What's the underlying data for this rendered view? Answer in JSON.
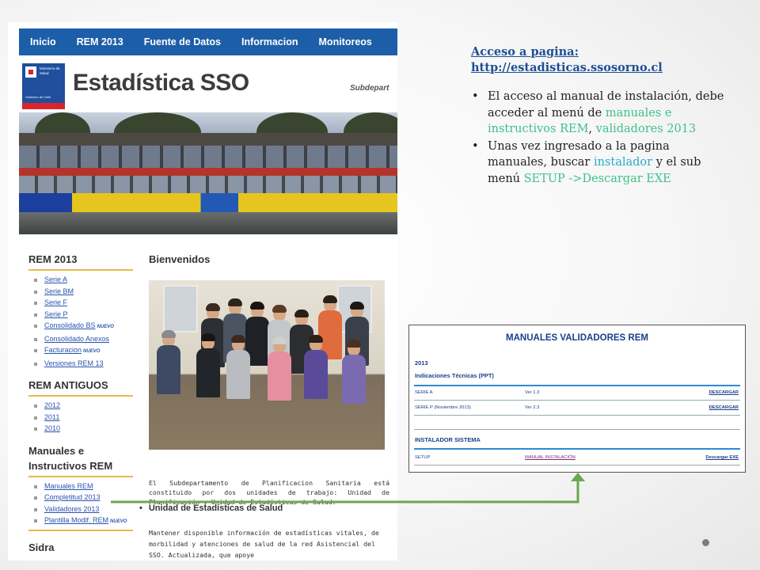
{
  "site": {
    "nav": [
      "Inicio",
      "REM 2013",
      "Fuente de Datos",
      "Informacion",
      "Monitoreos"
    ],
    "logo": {
      "line1": "Ministerio de",
      "line2": "Salud",
      "line3": "Gobierno de Chile"
    },
    "title": "Estadística SSO",
    "subtitle": "Subdepart",
    "sidebar": {
      "rem2013_heading": "REM 2013",
      "rem2013_items": [
        {
          "label": "Serie A",
          "badge": ""
        },
        {
          "label": "Serie BM",
          "badge": ""
        },
        {
          "label": "Serie F",
          "badge": ""
        },
        {
          "label": "Serie P",
          "badge": ""
        },
        {
          "label": "Consolidado BS",
          "badge": "NUEVO"
        },
        {
          "label": "Consolidado Anexos",
          "badge": ""
        },
        {
          "label": "Facturacion",
          "badge": "NUEVO"
        },
        {
          "label": "Versiones REM 13",
          "badge": ""
        }
      ],
      "antiguos_heading": "REM ANTIGUOS",
      "antiguos_items": [
        "2012",
        "2011",
        "2010"
      ],
      "manuales_heading_1": "Manuales e",
      "manuales_heading_2": "Instructivos REM",
      "manuales_items": [
        {
          "label": "Manuales REM",
          "badge": ""
        },
        {
          "label": "Completitud 2013",
          "badge": ""
        },
        {
          "label": "Validadores 2013",
          "badge": ""
        },
        {
          "label": "Plantilla Modif. REM",
          "badge": "NUEVO"
        }
      ],
      "sidra_heading": "Sidra"
    },
    "main": {
      "heading": "Bienvenidos",
      "welcome_text": "El Subdepartamento de Planificacion Sanitaria está constituido por dos unidades de trabajo: Unidad de Planificación y Unidad de Estadísticas de Salud.",
      "unit_heading": "Unidad de Estadísticas de Salud",
      "unit_text": "Mantener disponible información de estadísticas vitales, de morbilidad y atenciones de salud de la red Asistencial del SSO. Actualizada, que apoye"
    }
  },
  "note": {
    "title": "Acceso a pagina:",
    "url": "http://estadisticas.ssosorno.cl",
    "bullet1": {
      "text_a": "El acceso al manual de instalación, debe acceder al menú de ",
      "hl_a": "manuales e instructivos REM",
      "text_b": ", ",
      "hl_b": "validadores 2013"
    },
    "bullet2": {
      "text_a": "Unas vez ingresado a la pagina manuales, buscar ",
      "hl_a": "instalador",
      "text_b": " y el sub menú  ",
      "hl_b": "SETUP ->Descargar EXE"
    }
  },
  "panel": {
    "title": "MANUALES VALIDADORES REM",
    "year": "2013",
    "section1": "Indicaciones Técnicas (PPT)",
    "rows": [
      {
        "name": "SERIE A",
        "version": "Ver 1.3",
        "link": "DESCARGAR"
      },
      {
        "name": "SERIE P (Noviembre 2013)",
        "version": "Ver 2.3",
        "link": "DESCARGAR"
      }
    ],
    "section2": "INSTALADOR SISTEMA",
    "setup": {
      "name": "SETUP",
      "manual": "MANUAL INSTALACIÓN",
      "link": "Descargar EXE"
    }
  },
  "colors": {
    "nav": "#1d5ea8",
    "accent_gold": "#e9b94a",
    "arrow": "#6aa84f",
    "highlight_green": "#3ec18a",
    "highlight_teal": "#28aacb"
  }
}
